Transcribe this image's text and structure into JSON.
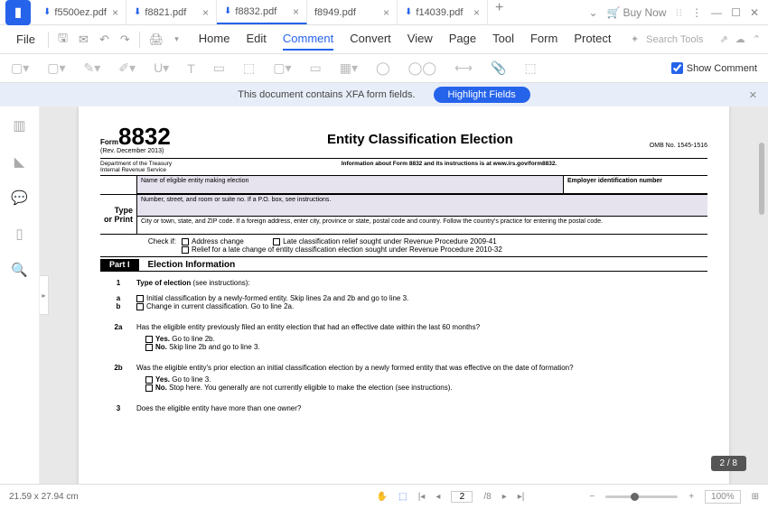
{
  "tabs": [
    {
      "name": "f5500ez.pdf"
    },
    {
      "name": "f8821.pdf"
    },
    {
      "name": "f8832.pdf"
    },
    {
      "name": "f8949.pdf"
    },
    {
      "name": "f14039.pdf"
    }
  ],
  "active_tab": 2,
  "buy_now": "Buy Now",
  "menu": {
    "file": "File",
    "items": [
      "Home",
      "Edit",
      "Comment",
      "Convert",
      "View",
      "Page",
      "Tool",
      "Form",
      "Protect"
    ],
    "active": "Comment",
    "search": "Search Tools"
  },
  "show_comment": "Show Comment",
  "banner": {
    "text": "This document contains XFA form fields.",
    "button": "Highlight Fields"
  },
  "form": {
    "prefix": "Form",
    "number": "8832",
    "rev": "(Rev. December 2013)",
    "dept": "Department of the Treasury  Internal Revenue Service",
    "title": "Entity Classification Election",
    "info": "Information about Form 8832 and its instructions is at www.irs.gov/form8832.",
    "omb": "OMB No. 1545-1516",
    "name_label": "Name of eligible entity making election",
    "ein_label": "Employer identification number",
    "type_print_a": "Type",
    "type_print_b": "or  Print",
    "addr_label": "Number, street, and room or suite no. If a P.O. box, see instructions.",
    "city_label": "City or town, state, and ZIP code. If a foreign address, enter city, province or state, postal code and country. Follow the country's practice for entering the  postal code.",
    "checkif": "Check if:",
    "check_a": "Address change",
    "check_b": "Late classification relief sought under Revenue Procedure 2009-41",
    "check_c": "Relief for a late change of entity classification election sought under Revenue Procedure 2010-32",
    "part": "Part I",
    "part_title": "Election Information",
    "q1": "Type of election",
    "q1_see": " (see instructions):",
    "q1a": "Initial classification by a newly-formed entity. Skip lines 2a and 2b and go to line 3.",
    "q1b": "Change in current classification. Go to line 2a.",
    "q2a": "Has the eligible entity previously filed an entity election that had an effective date within the last 60 months?",
    "q2a_yes": "Yes.",
    "q2a_yes_t": " Go to line 2b.",
    "q2a_no": "No.",
    "q2a_no_t": " Skip line 2b and go to line 3.",
    "q2b": "Was the eligible entity's prior election an initial classification election by a newly formed entity that was effective on the date of formation?",
    "q2b_yes": "Yes.",
    "q2b_yes_t": " Go to line 3.",
    "q2b_no": "No.",
    "q2b_no_t": " Stop here. You generally are not currently eligible to make the election (see instructions).",
    "q3": "Does the eligible entity have more than one owner?"
  },
  "page_indicator": "2 / 8",
  "status": {
    "dims": "21.59 x 27.94 cm",
    "page_cur": "2",
    "page_total": "/8",
    "zoom": "100%"
  }
}
